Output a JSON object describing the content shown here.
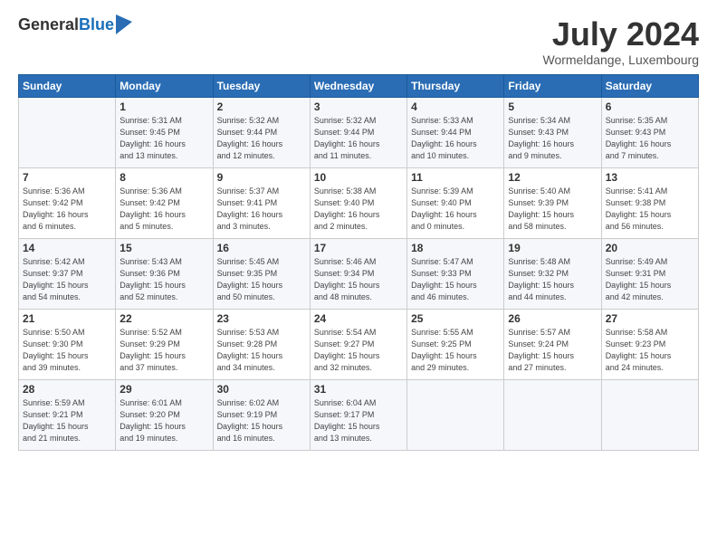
{
  "header": {
    "logo_general": "General",
    "logo_blue": "Blue",
    "month_title": "July 2024",
    "location": "Wormeldange, Luxembourg"
  },
  "days_of_week": [
    "Sunday",
    "Monday",
    "Tuesday",
    "Wednesday",
    "Thursday",
    "Friday",
    "Saturday"
  ],
  "weeks": [
    [
      {
        "day": "",
        "info": ""
      },
      {
        "day": "1",
        "info": "Sunrise: 5:31 AM\nSunset: 9:45 PM\nDaylight: 16 hours\nand 13 minutes."
      },
      {
        "day": "2",
        "info": "Sunrise: 5:32 AM\nSunset: 9:44 PM\nDaylight: 16 hours\nand 12 minutes."
      },
      {
        "day": "3",
        "info": "Sunrise: 5:32 AM\nSunset: 9:44 PM\nDaylight: 16 hours\nand 11 minutes."
      },
      {
        "day": "4",
        "info": "Sunrise: 5:33 AM\nSunset: 9:44 PM\nDaylight: 16 hours\nand 10 minutes."
      },
      {
        "day": "5",
        "info": "Sunrise: 5:34 AM\nSunset: 9:43 PM\nDaylight: 16 hours\nand 9 minutes."
      },
      {
        "day": "6",
        "info": "Sunrise: 5:35 AM\nSunset: 9:43 PM\nDaylight: 16 hours\nand 7 minutes."
      }
    ],
    [
      {
        "day": "7",
        "info": "Sunrise: 5:36 AM\nSunset: 9:42 PM\nDaylight: 16 hours\nand 6 minutes."
      },
      {
        "day": "8",
        "info": "Sunrise: 5:36 AM\nSunset: 9:42 PM\nDaylight: 16 hours\nand 5 minutes."
      },
      {
        "day": "9",
        "info": "Sunrise: 5:37 AM\nSunset: 9:41 PM\nDaylight: 16 hours\nand 3 minutes."
      },
      {
        "day": "10",
        "info": "Sunrise: 5:38 AM\nSunset: 9:40 PM\nDaylight: 16 hours\nand 2 minutes."
      },
      {
        "day": "11",
        "info": "Sunrise: 5:39 AM\nSunset: 9:40 PM\nDaylight: 16 hours\nand 0 minutes."
      },
      {
        "day": "12",
        "info": "Sunrise: 5:40 AM\nSunset: 9:39 PM\nDaylight: 15 hours\nand 58 minutes."
      },
      {
        "day": "13",
        "info": "Sunrise: 5:41 AM\nSunset: 9:38 PM\nDaylight: 15 hours\nand 56 minutes."
      }
    ],
    [
      {
        "day": "14",
        "info": "Sunrise: 5:42 AM\nSunset: 9:37 PM\nDaylight: 15 hours\nand 54 minutes."
      },
      {
        "day": "15",
        "info": "Sunrise: 5:43 AM\nSunset: 9:36 PM\nDaylight: 15 hours\nand 52 minutes."
      },
      {
        "day": "16",
        "info": "Sunrise: 5:45 AM\nSunset: 9:35 PM\nDaylight: 15 hours\nand 50 minutes."
      },
      {
        "day": "17",
        "info": "Sunrise: 5:46 AM\nSunset: 9:34 PM\nDaylight: 15 hours\nand 48 minutes."
      },
      {
        "day": "18",
        "info": "Sunrise: 5:47 AM\nSunset: 9:33 PM\nDaylight: 15 hours\nand 46 minutes."
      },
      {
        "day": "19",
        "info": "Sunrise: 5:48 AM\nSunset: 9:32 PM\nDaylight: 15 hours\nand 44 minutes."
      },
      {
        "day": "20",
        "info": "Sunrise: 5:49 AM\nSunset: 9:31 PM\nDaylight: 15 hours\nand 42 minutes."
      }
    ],
    [
      {
        "day": "21",
        "info": "Sunrise: 5:50 AM\nSunset: 9:30 PM\nDaylight: 15 hours\nand 39 minutes."
      },
      {
        "day": "22",
        "info": "Sunrise: 5:52 AM\nSunset: 9:29 PM\nDaylight: 15 hours\nand 37 minutes."
      },
      {
        "day": "23",
        "info": "Sunrise: 5:53 AM\nSunset: 9:28 PM\nDaylight: 15 hours\nand 34 minutes."
      },
      {
        "day": "24",
        "info": "Sunrise: 5:54 AM\nSunset: 9:27 PM\nDaylight: 15 hours\nand 32 minutes."
      },
      {
        "day": "25",
        "info": "Sunrise: 5:55 AM\nSunset: 9:25 PM\nDaylight: 15 hours\nand 29 minutes."
      },
      {
        "day": "26",
        "info": "Sunrise: 5:57 AM\nSunset: 9:24 PM\nDaylight: 15 hours\nand 27 minutes."
      },
      {
        "day": "27",
        "info": "Sunrise: 5:58 AM\nSunset: 9:23 PM\nDaylight: 15 hours\nand 24 minutes."
      }
    ],
    [
      {
        "day": "28",
        "info": "Sunrise: 5:59 AM\nSunset: 9:21 PM\nDaylight: 15 hours\nand 21 minutes."
      },
      {
        "day": "29",
        "info": "Sunrise: 6:01 AM\nSunset: 9:20 PM\nDaylight: 15 hours\nand 19 minutes."
      },
      {
        "day": "30",
        "info": "Sunrise: 6:02 AM\nSunset: 9:19 PM\nDaylight: 15 hours\nand 16 minutes."
      },
      {
        "day": "31",
        "info": "Sunrise: 6:04 AM\nSunset: 9:17 PM\nDaylight: 15 hours\nand 13 minutes."
      },
      {
        "day": "",
        "info": ""
      },
      {
        "day": "",
        "info": ""
      },
      {
        "day": "",
        "info": ""
      }
    ]
  ]
}
